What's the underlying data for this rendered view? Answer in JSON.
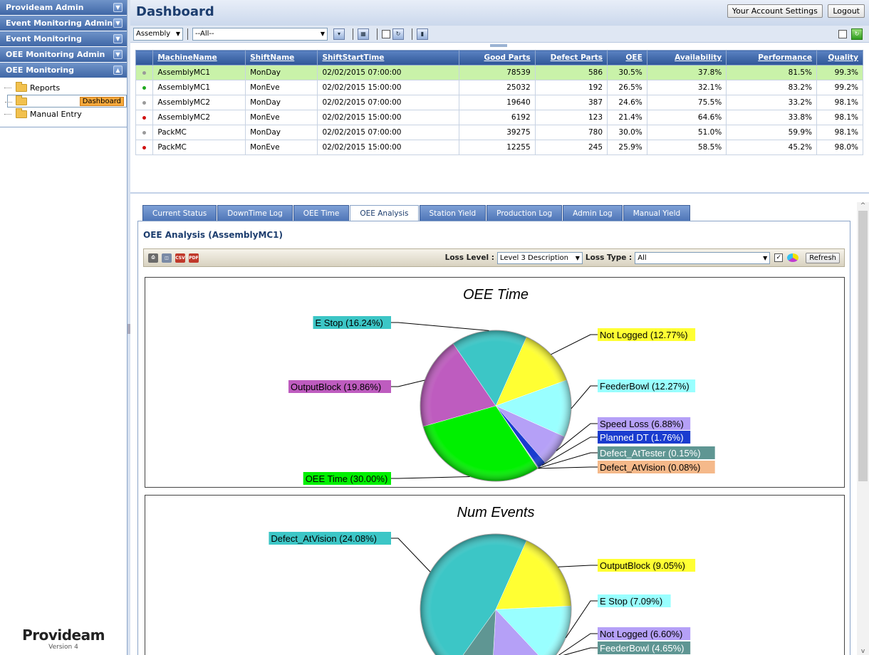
{
  "sidebar": {
    "sections": [
      {
        "label": "Provideam Admin"
      },
      {
        "label": "Event Monitoring Admin"
      },
      {
        "label": "Event Monitoring"
      },
      {
        "label": "OEE Monitoring Admin"
      },
      {
        "label": "OEE Monitoring"
      }
    ],
    "tree": [
      {
        "label": "Reports"
      },
      {
        "label": "Dashboard"
      },
      {
        "label": "Manual Entry"
      }
    ],
    "logo": {
      "brand": "Provideam",
      "version": "Version 4"
    }
  },
  "header": {
    "title": "Dashboard",
    "account_button": "Your Account Settings",
    "logout_button": "Logout"
  },
  "filters": {
    "group_value": "Assembly",
    "machine_value": "--All--"
  },
  "grid": {
    "columns": [
      "MachineName",
      "ShiftName",
      "ShiftStartTime",
      "Good Parts",
      "Defect Parts",
      "OEE",
      "Availability",
      "Performance",
      "Quality"
    ],
    "rows": [
      {
        "status": "gray",
        "machine": "AssemblyMC1",
        "shift": "MonDay",
        "start": "02/02/2015 07:00:00",
        "good": "78539",
        "defect": "586",
        "oee": "30.5%",
        "avail": "37.8%",
        "perf": "81.5%",
        "qual": "99.3%"
      },
      {
        "status": "green",
        "machine": "AssemblyMC1",
        "shift": "MonEve",
        "start": "02/02/2015 15:00:00",
        "good": "25032",
        "defect": "192",
        "oee": "26.5%",
        "avail": "32.1%",
        "perf": "83.2%",
        "qual": "99.2%"
      },
      {
        "status": "gray",
        "machine": "AssemblyMC2",
        "shift": "MonDay",
        "start": "02/02/2015 07:00:00",
        "good": "19640",
        "defect": "387",
        "oee": "24.6%",
        "avail": "75.5%",
        "perf": "33.2%",
        "qual": "98.1%"
      },
      {
        "status": "red",
        "machine": "AssemblyMC2",
        "shift": "MonEve",
        "start": "02/02/2015 15:00:00",
        "good": "6192",
        "defect": "123",
        "oee": "21.4%",
        "avail": "64.6%",
        "perf": "33.8%",
        "qual": "98.1%"
      },
      {
        "status": "gray",
        "machine": "PackMC",
        "shift": "MonDay",
        "start": "02/02/2015 07:00:00",
        "good": "39275",
        "defect": "780",
        "oee": "30.0%",
        "avail": "51.0%",
        "perf": "59.9%",
        "qual": "98.1%"
      },
      {
        "status": "red",
        "machine": "PackMC",
        "shift": "MonEve",
        "start": "02/02/2015 15:00:00",
        "good": "12255",
        "defect": "245",
        "oee": "25.9%",
        "avail": "58.5%",
        "perf": "45.2%",
        "qual": "98.0%"
      }
    ]
  },
  "tabs": [
    {
      "label": "Current Status"
    },
    {
      "label": "DownTime Log"
    },
    {
      "label": "OEE Time"
    },
    {
      "label": "OEE Analysis",
      "active": true
    },
    {
      "label": "Station Yield"
    },
    {
      "label": "Production Log"
    },
    {
      "label": "Admin Log"
    },
    {
      "label": "Manual Yield"
    }
  ],
  "panel": {
    "title": "OEE Analysis (AssemblyMC1)",
    "toolbar_icons": [
      "print-icon",
      "preview-icon",
      "csv-icon",
      "pdf-icon"
    ],
    "loss_level_label": "Loss Level :",
    "loss_level_value": "Level 3 Description",
    "loss_type_label": "Loss Type :",
    "loss_type_value": "All",
    "refresh_button": "Refresh"
  },
  "colors": {
    "header_blue": "#3f67a6",
    "highlight_row": "#c9f2a9"
  },
  "chart_data": [
    {
      "type": "pie",
      "title": "OEE Time",
      "slices": [
        {
          "label": "Not Logged",
          "value": 12.77,
          "color": "#ffff33"
        },
        {
          "label": "FeederBowl",
          "value": 12.27,
          "color": "#99ffff"
        },
        {
          "label": "Speed Loss",
          "value": 6.88,
          "color": "#b5a0f7"
        },
        {
          "label": "Planned DT",
          "value": 1.76,
          "color": "#1a3ccf"
        },
        {
          "label": "Defect_AtTester",
          "value": 0.15,
          "color": "#5f9693"
        },
        {
          "label": "Defect_AtVision",
          "value": 0.08,
          "color": "#f5b98a"
        },
        {
          "label": "OEE Time",
          "value": 30.0,
          "color": "#00f000"
        },
        {
          "label": "OutputBlock",
          "value": 19.86,
          "color": "#be5cbf"
        },
        {
          "label": "E Stop",
          "value": 16.24,
          "color": "#3cc6c6"
        }
      ]
    },
    {
      "type": "pie",
      "title": "Num Events",
      "slices": [
        {
          "label": "OutputBlock",
          "value": 9.05,
          "color": "#ffff33"
        },
        {
          "label": "E Stop",
          "value": 7.09,
          "color": "#99ffff"
        },
        {
          "label": "Not Logged",
          "value": 6.6,
          "color": "#b5a0f7"
        },
        {
          "label": "FeederBowl",
          "value": 4.65,
          "color": "#5f9693"
        },
        {
          "label": "Defect_AtVision",
          "value": 24.08,
          "color": "#3cc6c6"
        }
      ]
    }
  ]
}
